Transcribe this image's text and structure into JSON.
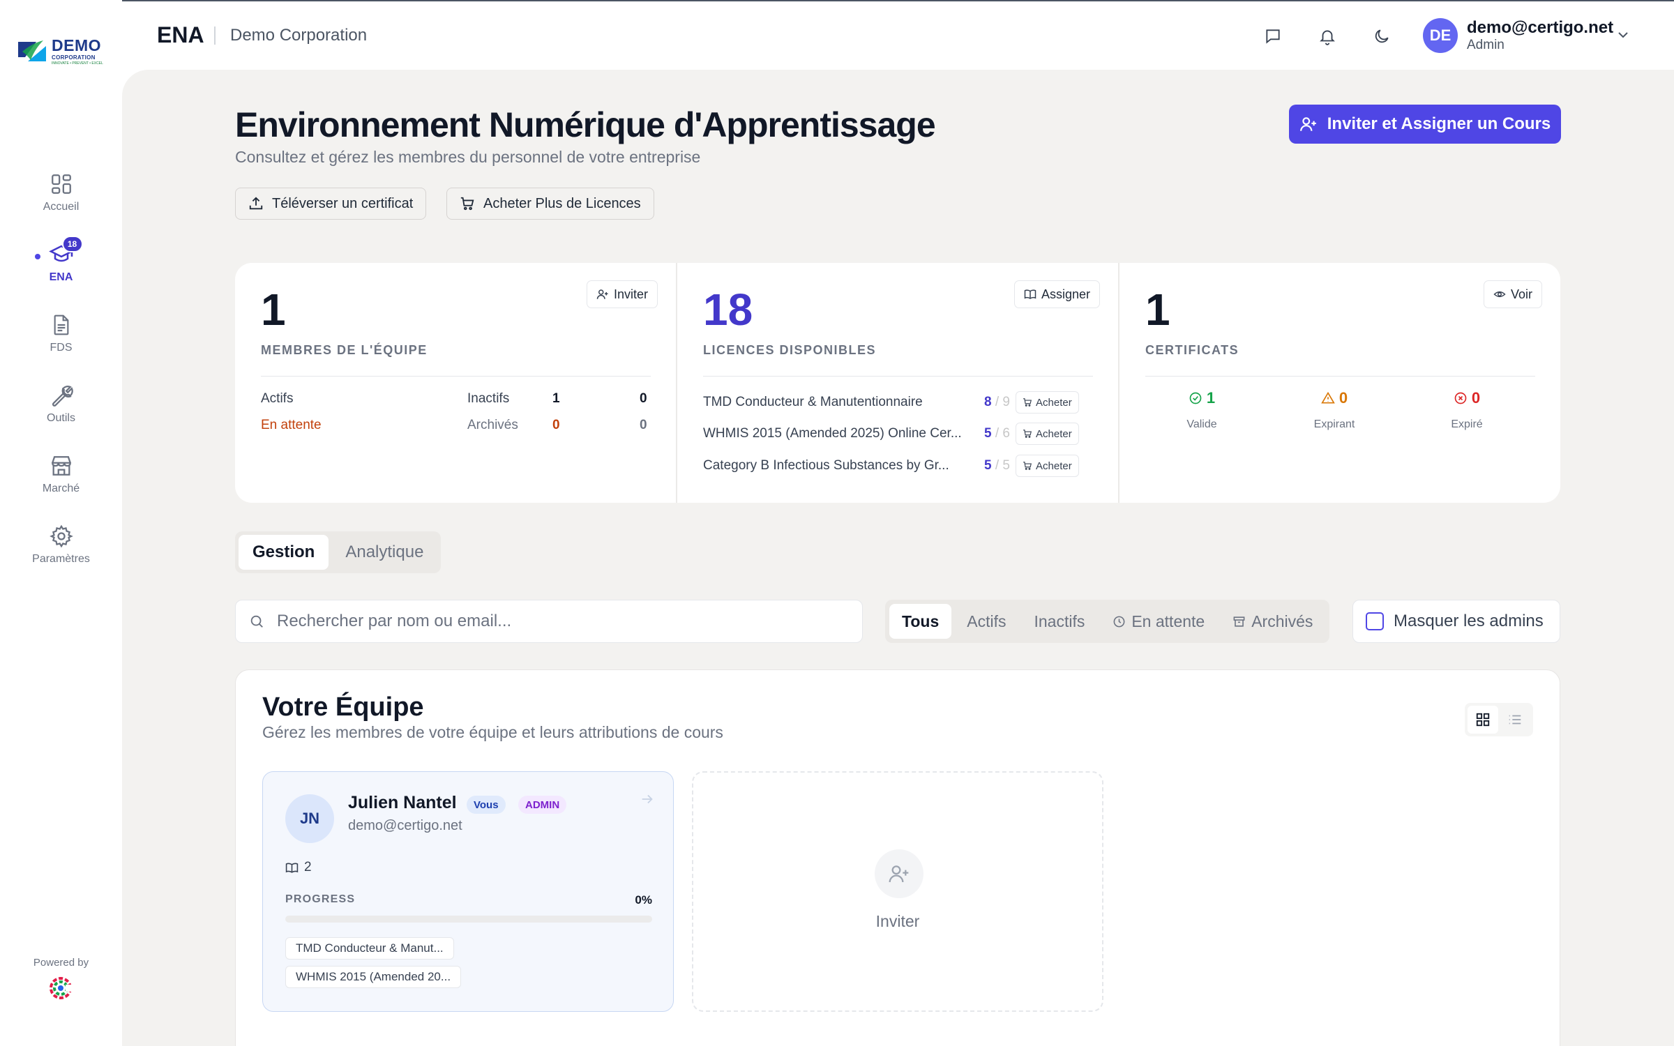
{
  "app": {
    "logo": {
      "line1": "DEMO",
      "line2": "CORPORATION",
      "line3": "INNOVATE • PREVENT • EXCEL"
    },
    "powered_by": "Powered by"
  },
  "sidebar": {
    "items": [
      {
        "label": "Accueil",
        "icon": "dashboard-grid-icon",
        "active": false
      },
      {
        "label": "ENA",
        "icon": "graduation-cap-icon",
        "active": true,
        "badge": "18"
      },
      {
        "label": "FDS",
        "icon": "document-icon",
        "active": false
      },
      {
        "label": "Outils",
        "icon": "wrench-icon",
        "active": false
      },
      {
        "label": "Marché",
        "icon": "store-icon",
        "active": false
      },
      {
        "label": "Paramètres",
        "icon": "gear-icon",
        "active": false
      }
    ]
  },
  "header": {
    "title": "ENA",
    "company": "Demo Corporation",
    "user": {
      "initials": "DE",
      "email": "demo@certigo.net",
      "role": "Admin"
    }
  },
  "page": {
    "title": "Environnement Numérique d'Apprentissage",
    "subtitle": "Consultez et gérez les membres du personnel de votre entreprise",
    "primary_button": "Inviter et Assigner un Cours",
    "upload_button": "Téléverser un certificat",
    "buy_button": "Acheter Plus de Licences"
  },
  "stats": {
    "team": {
      "value": "1",
      "label": "MEMBRES DE L'ÉQUIPE",
      "button": "Inviter",
      "rows": [
        {
          "label": "Actifs",
          "value": "1"
        },
        {
          "label": "Inactifs",
          "value": "0"
        },
        {
          "label": "En attente",
          "value": "0"
        },
        {
          "label": "Archivés",
          "value": "0"
        }
      ]
    },
    "licenses": {
      "value": "18",
      "label": "LICENCES DISPONIBLES",
      "button": "Assigner",
      "buy_label": "Acheter",
      "items": [
        {
          "name": "TMD Conducteur & Manutentionnaire",
          "available": "8",
          "total": "9"
        },
        {
          "name": "WHMIS 2015 (Amended 2025) Online Cer...",
          "available": "5",
          "total": "6"
        },
        {
          "name": "Category B Infectious Substances by Gr...",
          "available": "5",
          "total": "5"
        }
      ]
    },
    "certificates": {
      "value": "1",
      "label": "CERTIFICATS",
      "button": "Voir",
      "breakdown": [
        {
          "label": "Valide",
          "value": "1",
          "color": "#16a34a"
        },
        {
          "label": "Expirant",
          "value": "0",
          "color": "#d97706"
        },
        {
          "label": "Expiré",
          "value": "0",
          "color": "#dc2626"
        }
      ]
    }
  },
  "tabs": [
    {
      "label": "Gestion",
      "active": true
    },
    {
      "label": "Analytique",
      "active": false
    }
  ],
  "search": {
    "placeholder": "Rechercher par nom ou email...",
    "value": ""
  },
  "filters": [
    {
      "label": "Tous",
      "active": true
    },
    {
      "label": "Actifs",
      "active": false
    },
    {
      "label": "Inactifs",
      "active": false
    },
    {
      "label": "En attente",
      "active": false,
      "icon": "clock-icon"
    },
    {
      "label": "Archivés",
      "active": false,
      "icon": "archive-icon"
    }
  ],
  "hide_admins": {
    "label": "Masquer les admins",
    "checked": false
  },
  "team": {
    "title": "Votre Équipe",
    "subtitle": "Gérez les membres de votre équipe et leurs attributions de cours",
    "members": [
      {
        "initials": "JN",
        "name": "Julien Nantel",
        "you_badge": "Vous",
        "role_badge": "ADMIN",
        "email": "demo@certigo.net",
        "courses": "2",
        "progress_label": "PROGRESS",
        "progress": "0%",
        "progress_fraction": 0,
        "course_chips": [
          "TMD Conducteur & Manut...",
          "WHMIS 2015 (Amended 20..."
        ]
      }
    ],
    "invite_label": "Inviter"
  },
  "colors": {
    "accent": "#4f46e5",
    "accent_dark": "#4338ca",
    "background": "#f3f2f0"
  }
}
